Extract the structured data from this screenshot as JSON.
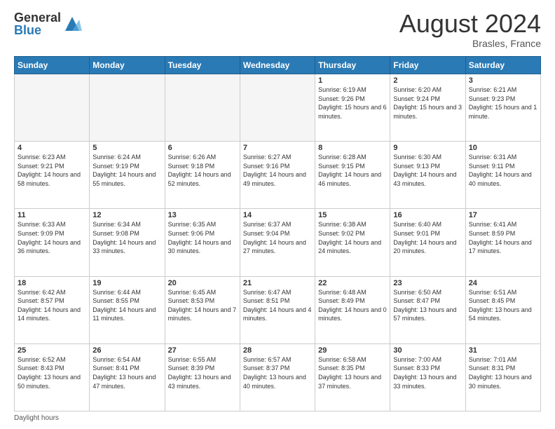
{
  "header": {
    "logo_general": "General",
    "logo_blue": "Blue",
    "month_title": "August 2024",
    "location": "Brasles, France"
  },
  "days_of_week": [
    "Sunday",
    "Monday",
    "Tuesday",
    "Wednesday",
    "Thursday",
    "Friday",
    "Saturday"
  ],
  "footer": {
    "note": "Daylight hours"
  },
  "weeks": [
    [
      {
        "day": "",
        "empty": true
      },
      {
        "day": "",
        "empty": true
      },
      {
        "day": "",
        "empty": true
      },
      {
        "day": "",
        "empty": true
      },
      {
        "day": "1",
        "sunrise": "6:19 AM",
        "sunset": "9:26 PM",
        "daylight": "15 hours and 6 minutes."
      },
      {
        "day": "2",
        "sunrise": "6:20 AM",
        "sunset": "9:24 PM",
        "daylight": "15 hours and 3 minutes."
      },
      {
        "day": "3",
        "sunrise": "6:21 AM",
        "sunset": "9:23 PM",
        "daylight": "15 hours and 1 minute."
      }
    ],
    [
      {
        "day": "4",
        "sunrise": "6:23 AM",
        "sunset": "9:21 PM",
        "daylight": "14 hours and 58 minutes."
      },
      {
        "day": "5",
        "sunrise": "6:24 AM",
        "sunset": "9:19 PM",
        "daylight": "14 hours and 55 minutes."
      },
      {
        "day": "6",
        "sunrise": "6:26 AM",
        "sunset": "9:18 PM",
        "daylight": "14 hours and 52 minutes."
      },
      {
        "day": "7",
        "sunrise": "6:27 AM",
        "sunset": "9:16 PM",
        "daylight": "14 hours and 49 minutes."
      },
      {
        "day": "8",
        "sunrise": "6:28 AM",
        "sunset": "9:15 PM",
        "daylight": "14 hours and 46 minutes."
      },
      {
        "day": "9",
        "sunrise": "6:30 AM",
        "sunset": "9:13 PM",
        "daylight": "14 hours and 43 minutes."
      },
      {
        "day": "10",
        "sunrise": "6:31 AM",
        "sunset": "9:11 PM",
        "daylight": "14 hours and 40 minutes."
      }
    ],
    [
      {
        "day": "11",
        "sunrise": "6:33 AM",
        "sunset": "9:09 PM",
        "daylight": "14 hours and 36 minutes."
      },
      {
        "day": "12",
        "sunrise": "6:34 AM",
        "sunset": "9:08 PM",
        "daylight": "14 hours and 33 minutes."
      },
      {
        "day": "13",
        "sunrise": "6:35 AM",
        "sunset": "9:06 PM",
        "daylight": "14 hours and 30 minutes."
      },
      {
        "day": "14",
        "sunrise": "6:37 AM",
        "sunset": "9:04 PM",
        "daylight": "14 hours and 27 minutes."
      },
      {
        "day": "15",
        "sunrise": "6:38 AM",
        "sunset": "9:02 PM",
        "daylight": "14 hours and 24 minutes."
      },
      {
        "day": "16",
        "sunrise": "6:40 AM",
        "sunset": "9:01 PM",
        "daylight": "14 hours and 20 minutes."
      },
      {
        "day": "17",
        "sunrise": "6:41 AM",
        "sunset": "8:59 PM",
        "daylight": "14 hours and 17 minutes."
      }
    ],
    [
      {
        "day": "18",
        "sunrise": "6:42 AM",
        "sunset": "8:57 PM",
        "daylight": "14 hours and 14 minutes."
      },
      {
        "day": "19",
        "sunrise": "6:44 AM",
        "sunset": "8:55 PM",
        "daylight": "14 hours and 11 minutes."
      },
      {
        "day": "20",
        "sunrise": "6:45 AM",
        "sunset": "8:53 PM",
        "daylight": "14 hours and 7 minutes."
      },
      {
        "day": "21",
        "sunrise": "6:47 AM",
        "sunset": "8:51 PM",
        "daylight": "14 hours and 4 minutes."
      },
      {
        "day": "22",
        "sunrise": "6:48 AM",
        "sunset": "8:49 PM",
        "daylight": "14 hours and 0 minutes."
      },
      {
        "day": "23",
        "sunrise": "6:50 AM",
        "sunset": "8:47 PM",
        "daylight": "13 hours and 57 minutes."
      },
      {
        "day": "24",
        "sunrise": "6:51 AM",
        "sunset": "8:45 PM",
        "daylight": "13 hours and 54 minutes."
      }
    ],
    [
      {
        "day": "25",
        "sunrise": "6:52 AM",
        "sunset": "8:43 PM",
        "daylight": "13 hours and 50 minutes."
      },
      {
        "day": "26",
        "sunrise": "6:54 AM",
        "sunset": "8:41 PM",
        "daylight": "13 hours and 47 minutes."
      },
      {
        "day": "27",
        "sunrise": "6:55 AM",
        "sunset": "8:39 PM",
        "daylight": "13 hours and 43 minutes."
      },
      {
        "day": "28",
        "sunrise": "6:57 AM",
        "sunset": "8:37 PM",
        "daylight": "13 hours and 40 minutes."
      },
      {
        "day": "29",
        "sunrise": "6:58 AM",
        "sunset": "8:35 PM",
        "daylight": "13 hours and 37 minutes."
      },
      {
        "day": "30",
        "sunrise": "7:00 AM",
        "sunset": "8:33 PM",
        "daylight": "13 hours and 33 minutes."
      },
      {
        "day": "31",
        "sunrise": "7:01 AM",
        "sunset": "8:31 PM",
        "daylight": "13 hours and 30 minutes."
      }
    ]
  ]
}
